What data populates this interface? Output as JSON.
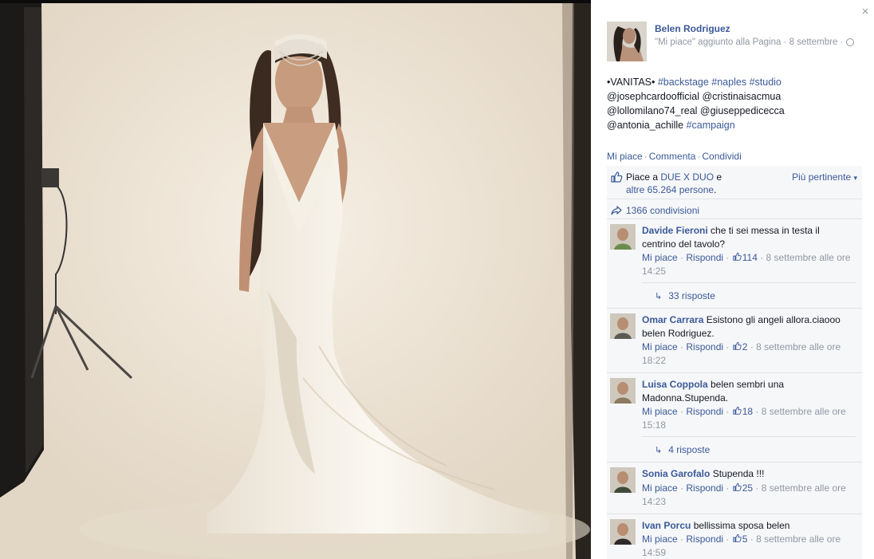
{
  "close": {
    "icon": "close-icon",
    "glyph": "×"
  },
  "author": {
    "name": "Belen Rodriguez",
    "meta": "\"Mi piace\" aggiunto alla Pagina · 8 settembre ·"
  },
  "caption": {
    "parts": [
      {
        "text": "•VANITAS• ",
        "tag": false
      },
      {
        "text": "#backstage",
        "tag": true
      },
      {
        "text": " ",
        "tag": false
      },
      {
        "text": "#naples",
        "tag": true
      },
      {
        "text": " ",
        "tag": false
      },
      {
        "text": "#studio",
        "tag": true
      },
      {
        "text": " @josephcardoofficial @cristinaisacmua @lollomilano74_real @giuseppedicecca @antonia_achille ",
        "tag": false
      },
      {
        "text": "#campaign",
        "tag": true
      }
    ]
  },
  "actions": {
    "like": "Mi piace",
    "comment": "Commenta",
    "share": "Condividi",
    "sep": "·"
  },
  "likes": {
    "prefix": "Piace a ",
    "page_link": "DUE X DUO",
    "mid": " e",
    "others_link": "altre 65.264 persone",
    "suffix": ".",
    "sort_label": "Più pertinente",
    "sort_arrow": "▾"
  },
  "shares": {
    "label": "1366 condivisioni"
  },
  "comments": [
    {
      "author": "Davide Fieroni",
      "text": " che ti sei messa in testa il centrino del tavolo?",
      "like": "Mi piace",
      "reply": "Rispondi",
      "likes": "114",
      "time": "8 settembre alle ore 14:25",
      "replies": "33 risposte",
      "avatar_color": "#6a8d4e"
    },
    {
      "author": "Omar Carrara",
      "text": " Esistono gli angeli allora.ciaooo belen Rodriguez.",
      "like": "Mi piace",
      "reply": "Rispondi",
      "likes": "2",
      "time": "8 settembre alle ore 18:22",
      "replies": "",
      "avatar_color": "#5c5a52"
    },
    {
      "author": "Luisa Coppola",
      "text": " belen sembri una Madonna.Stupenda.",
      "like": "Mi piace",
      "reply": "Rispondi",
      "likes": "18",
      "time": "8 settembre alle ore 15:18",
      "replies": "4 risposte",
      "avatar_color": "#8a7a60"
    },
    {
      "author": "Sonia Garofalo",
      "text": " Stupenda !!!",
      "like": "Mi piace",
      "reply": "Rispondi",
      "likes": "25",
      "time": "8 settembre alle ore 14:23",
      "replies": "",
      "avatar_color": "#3f4a3a"
    },
    {
      "author": "Ivan Porcu",
      "text": " bellissima sposa belen",
      "like": "Mi piace",
      "reply": "Rispondi",
      "likes": "5",
      "time": "8 settembre alle ore 14:59",
      "replies": "",
      "avatar_color": "#2e2a28"
    }
  ],
  "colors": {
    "link": "#3b5998",
    "muted": "#9197a3",
    "panel_bg": "#f6f7f9"
  }
}
